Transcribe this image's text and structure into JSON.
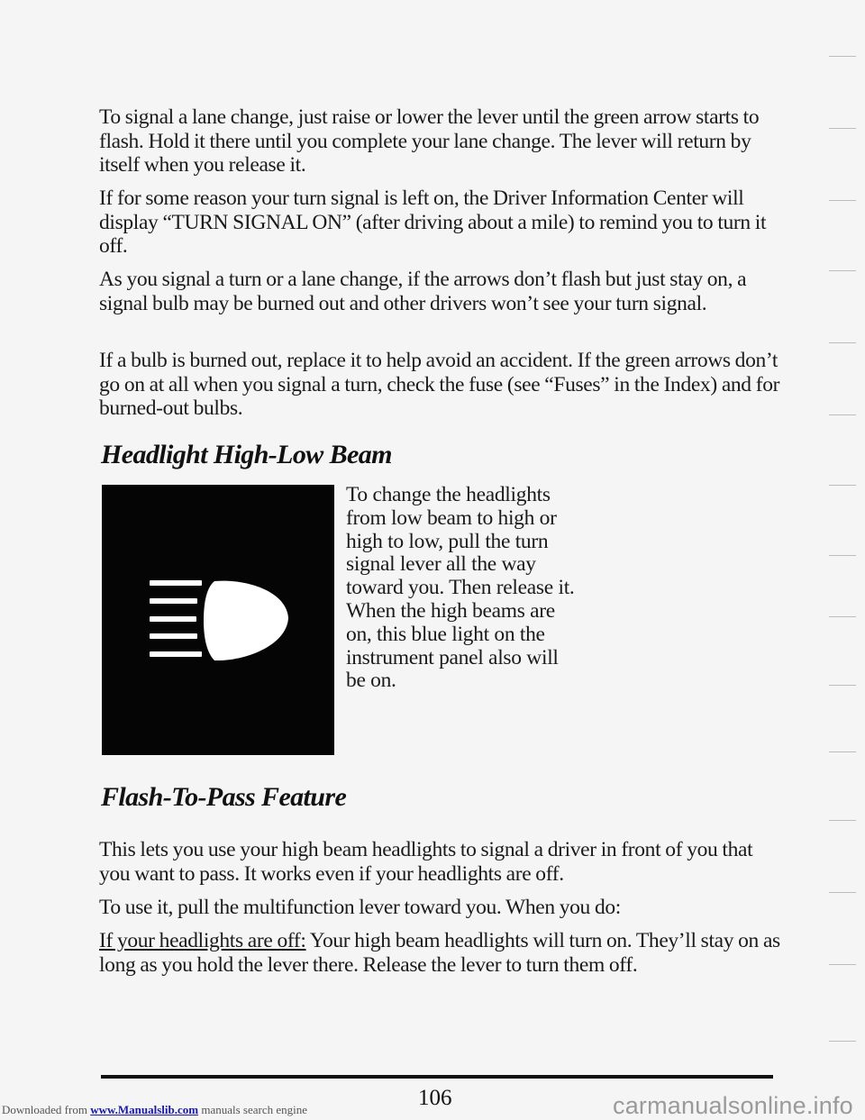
{
  "section1": {
    "paragraphs": [
      "To signal a lane change, just raise or lower the lever until the green arrow starts to flash. Hold it there until you complete your lane change. The lever will return by itself when you release it.",
      "If for some reason your turn signal is left on, the Driver Information Center will display “TURN SIGNAL ON” (after driving about a mile) to remind you to turn it off.",
      "As you signal a turn or a lane change, if the arrows don’t flash but just stay on, a signal bulb may be burned out and other drivers won’t see your turn signal.",
      "If a bulb is burned out, replace it to help avoid an accident. If the green arrows don’t go on at all when you signal a turn, check the fuse (see “Fuses” in the Index) and for burned-out bulbs."
    ]
  },
  "section2": {
    "heading": "Headlight High-Low Beam",
    "icon": "high-beam-indicator-icon",
    "body": "To change the headlights from low beam to high or high to low, pull the turn signal lever all the way toward you. Then release it. When the high beams are on, this blue light on the instrument panel also will be on."
  },
  "section3": {
    "heading": "Flash-To-Pass Feature",
    "paragraphs": [
      "This lets you use your high beam headlights to signal a driver in front of you that you want to pass. It works even if your headlights are off.",
      "To use it, pull the multifunction lever toward you. When you do:"
    ],
    "conditional": {
      "label": "If your headlights are off:",
      "text": " Your high beam headlights will turn on. They’ll stay on as long as you hold the lever there. Release the lever to turn them off."
    }
  },
  "footer": {
    "page_number": "106",
    "downloaded_prefix": "Downloaded from ",
    "link_text": "www.Manualslib.com",
    "downloaded_suffix": " manuals search engine",
    "watermark": "carmanualsonline.info"
  },
  "colors": {
    "page_background": "#f5f5f5",
    "text": "#1a1a1a",
    "icon_background": "#050505",
    "icon_foreground": "#ffffff",
    "link": "#1a1aa6",
    "watermark": "#9a9a9a"
  }
}
